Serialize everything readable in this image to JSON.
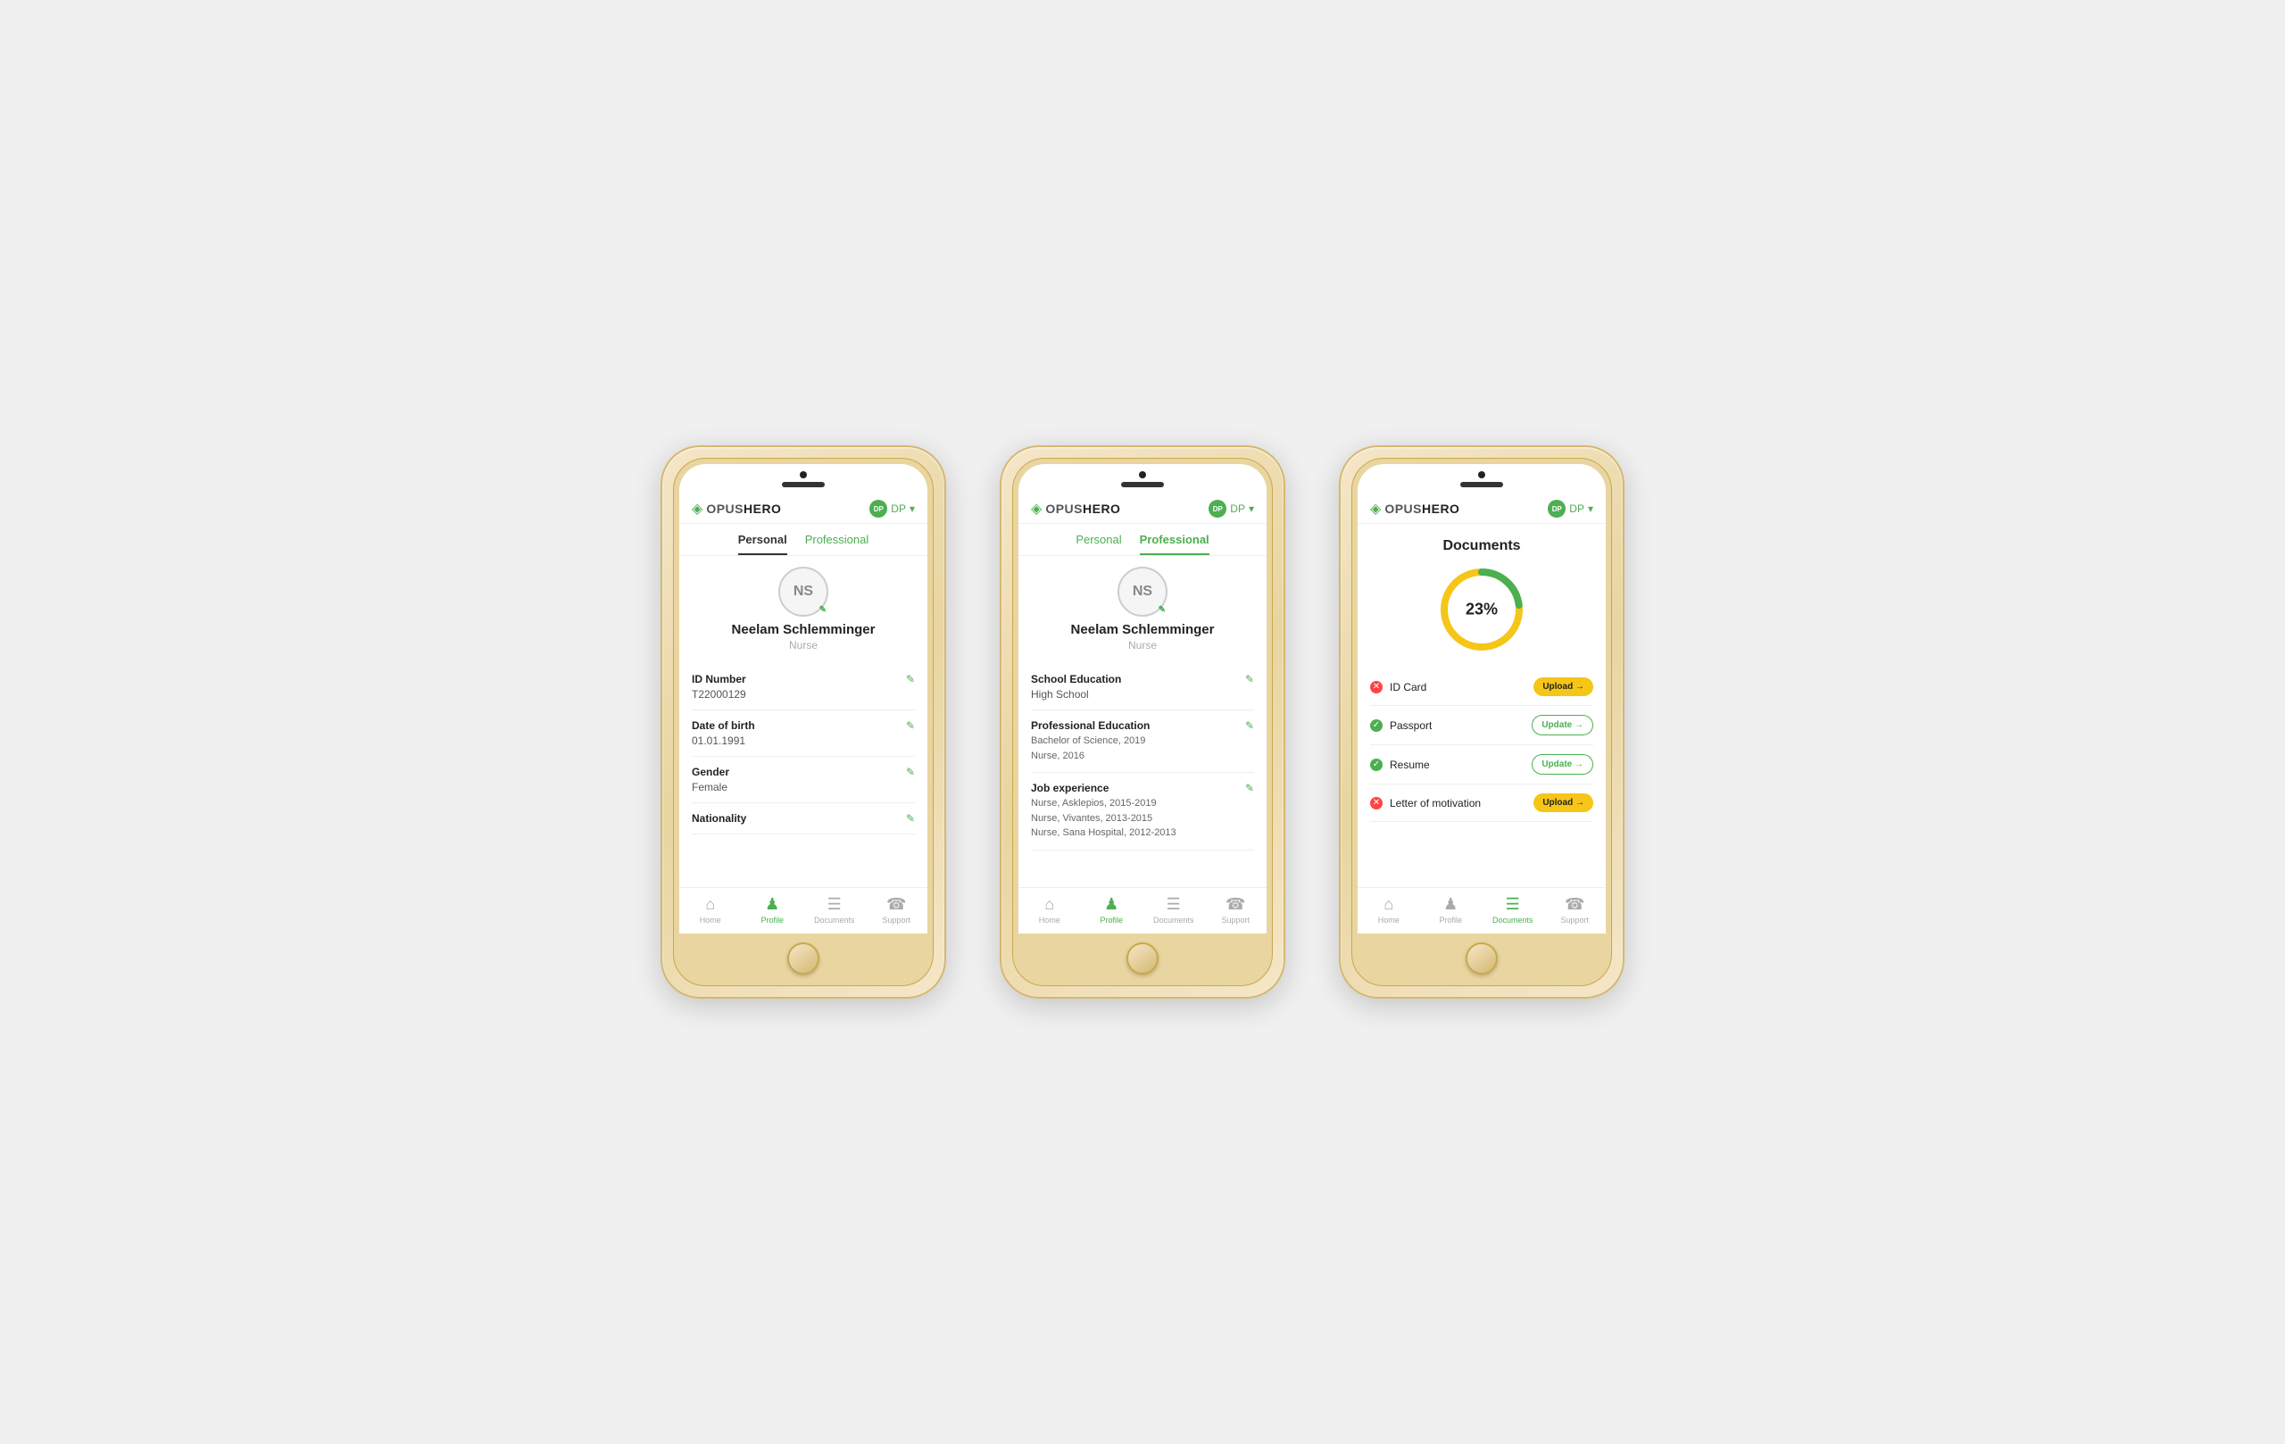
{
  "app": {
    "logo_opus": "OPUS",
    "logo_hero": "HERO",
    "logo_icon": "◈",
    "user_initials": "DP",
    "user_avatar_text": "DP",
    "chevron": "▾"
  },
  "phone1": {
    "tab_personal": "Personal",
    "tab_professional": "Professional",
    "user_initials": "NS",
    "user_name": "Neelam Schlemminger",
    "user_role": "Nurse",
    "fields": [
      {
        "label": "ID Number",
        "value": "T22000129"
      },
      {
        "label": "Date of birth",
        "value": "01.01.1991"
      },
      {
        "label": "Gender",
        "value": "Female"
      },
      {
        "label": "Nationality",
        "value": ""
      }
    ],
    "nav": [
      "Home",
      "Profile",
      "Documents",
      "Support"
    ],
    "nav_active": "Profile"
  },
  "phone2": {
    "tab_personal": "Personal",
    "tab_professional": "Professional",
    "user_initials": "NS",
    "user_name": "Neelam Schlemminger",
    "user_role": "Nurse",
    "fields": [
      {
        "label": "School Education",
        "values": [
          "High School"
        ]
      },
      {
        "label": "Professional Education",
        "values": [
          "Bachelor of Science, 2019",
          "Nurse, 2016"
        ]
      },
      {
        "label": "Job experience",
        "values": [
          "Nurse, Asklepios, 2015-2019",
          "Nurse, Vivantes, 2013-2015",
          "Nurse, Sana Hospital, 2012-2013"
        ]
      }
    ],
    "nav": [
      "Home",
      "Profile",
      "Documents",
      "Support"
    ],
    "nav_active": "Profile"
  },
  "phone3": {
    "section_title": "Documents",
    "progress_pct": "23%",
    "progress_value": 23,
    "documents": [
      {
        "name": "ID Card",
        "status": "missing",
        "action": "Upload →"
      },
      {
        "name": "Passport",
        "status": "ok",
        "action": "Update →"
      },
      {
        "name": "Resume",
        "status": "ok",
        "action": "Update →"
      },
      {
        "name": "Letter of motivation",
        "status": "missing",
        "action": "Upload →"
      }
    ],
    "nav": [
      "Home",
      "Profile",
      "Documents",
      "Support"
    ],
    "nav_active": "Documents"
  }
}
